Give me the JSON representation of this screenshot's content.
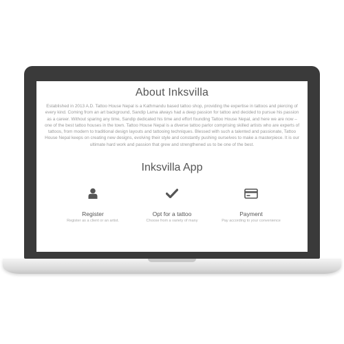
{
  "about": {
    "title": "About Inksvilla",
    "body": "Established in 2013 A.D. Tattoo House Nepal is a Kathmandu based tattoo shop, providing the expertise in tattoos and piercing of every kind. Coming from an art background, Sandip Lama always had a deep passion for tattoo and decided to pursue his passion as a career. Without sparing any time, Sandip dedicated his time and effort founding Tattoo House Nepal, and here we are now – one of the best tattoo houses in the town. Tattoo House Nepal is a diverse tattoo parlor comprising skilled artists who are experts of tattoos, from modern to traditional design layouts and tattooing techniques. Blessed with such a talented and passionate, Tattoo House Nepal keeps on creating new designs, evolving their style and constantly pushing ourselves to make a masterpiece. It is our ultimate hard work and passion that grew and strengthened us to be one of the best."
  },
  "app": {
    "title": "Inksvilla App",
    "features": [
      {
        "icon": "user-icon",
        "label": "Register",
        "sub": "Register as a client or an artist."
      },
      {
        "icon": "checkmark-icon",
        "label": "Opt for a tattoo",
        "sub": "Choose from a variety of many"
      },
      {
        "icon": "credit-card-icon",
        "label": "Payment",
        "sub": "Pay according to your convenience"
      }
    ]
  }
}
